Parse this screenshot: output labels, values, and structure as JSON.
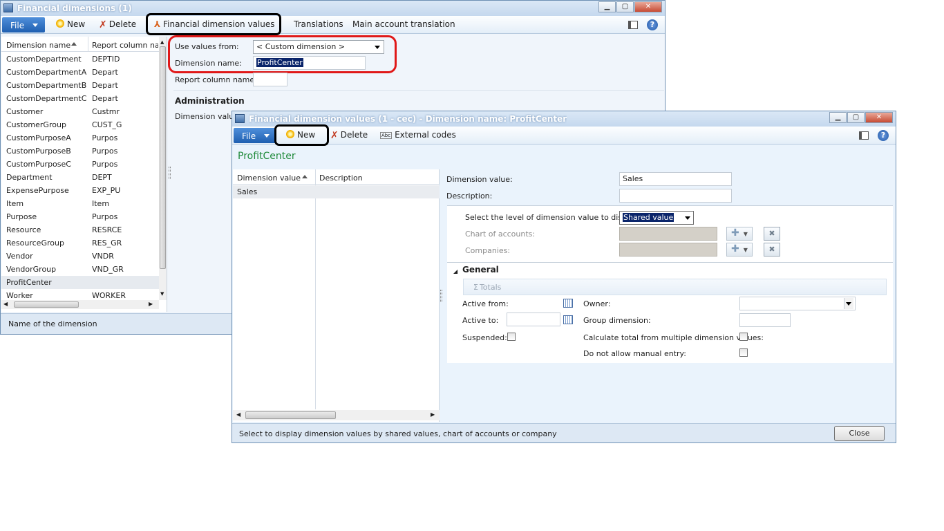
{
  "win1": {
    "title": "Financial dimensions (1)",
    "ribbon": {
      "file": "File",
      "new": "New",
      "delete": "Delete",
      "fin_dim_values": "Financial dimension values",
      "translations": "Translations",
      "main_account_translation": "Main account translation"
    },
    "grid": {
      "col1": "Dimension name",
      "col2": "Report column nam",
      "rows": [
        [
          "CustomDepartment",
          "DEPTID"
        ],
        [
          "CustomDepartmentA",
          "Depart"
        ],
        [
          "CustomDepartmentB",
          "Depart"
        ],
        [
          "CustomDepartmentC",
          "Depart"
        ],
        [
          "Customer",
          "Custmr"
        ],
        [
          "CustomerGroup",
          "CUST_G"
        ],
        [
          "CustomPurposeA",
          "Purpos"
        ],
        [
          "CustomPurposeB",
          "Purpos"
        ],
        [
          "CustomPurposeC",
          "Purpos"
        ],
        [
          "Department",
          "DEPT"
        ],
        [
          "ExpensePurpose",
          "EXP_PU"
        ],
        [
          "Item",
          "Item"
        ],
        [
          "Purpose",
          "Purpos"
        ],
        [
          "Resource",
          "RESRCE"
        ],
        [
          "ResourceGroup",
          "RES_GR"
        ],
        [
          "Vendor",
          "VNDR"
        ],
        [
          "VendorGroup",
          "VND_GR"
        ],
        [
          "ProfitCenter",
          ""
        ],
        [
          "Worker",
          "WORKER"
        ]
      ]
    },
    "form": {
      "use_values_label": "Use values from:",
      "use_values_value": "< Custom dimension >",
      "dim_name_label": "Dimension name:",
      "dim_name_value": "ProfitCenter",
      "report_col_label": "Report column name:",
      "admin_header": "Administration",
      "dim_value_label": "Dimension value i"
    },
    "status": "Name of the dimension"
  },
  "win2": {
    "title": "Financial dimension values (1 - cec) - Dimension name: ProfitCenter",
    "ribbon": {
      "file": "File",
      "new": "New",
      "delete": "Delete",
      "external_codes": "External codes"
    },
    "heading": "ProfitCenter",
    "grid": {
      "col1": "Dimension value",
      "col2": "Description",
      "rows": [
        [
          "Sales",
          ""
        ]
      ]
    },
    "form": {
      "dim_value_label": "Dimension value:",
      "dim_value": "Sales",
      "description_label": "Description:",
      "level_label": "Select the level of dimension value to display:",
      "level_value": "Shared value",
      "chart_label": "Chart of accounts:",
      "companies_label": "Companies:",
      "general": "General",
      "totals": "Totals",
      "active_from": "Active from:",
      "active_to": "Active to:",
      "suspended": "Suspended:",
      "owner": "Owner:",
      "group_dimension": "Group dimension:",
      "calc_total": "Calculate total from multiple dimension values:",
      "no_manual": "Do not allow manual entry:"
    },
    "status": "Select to display dimension values by shared values, chart of accounts or company",
    "close": "Close"
  }
}
